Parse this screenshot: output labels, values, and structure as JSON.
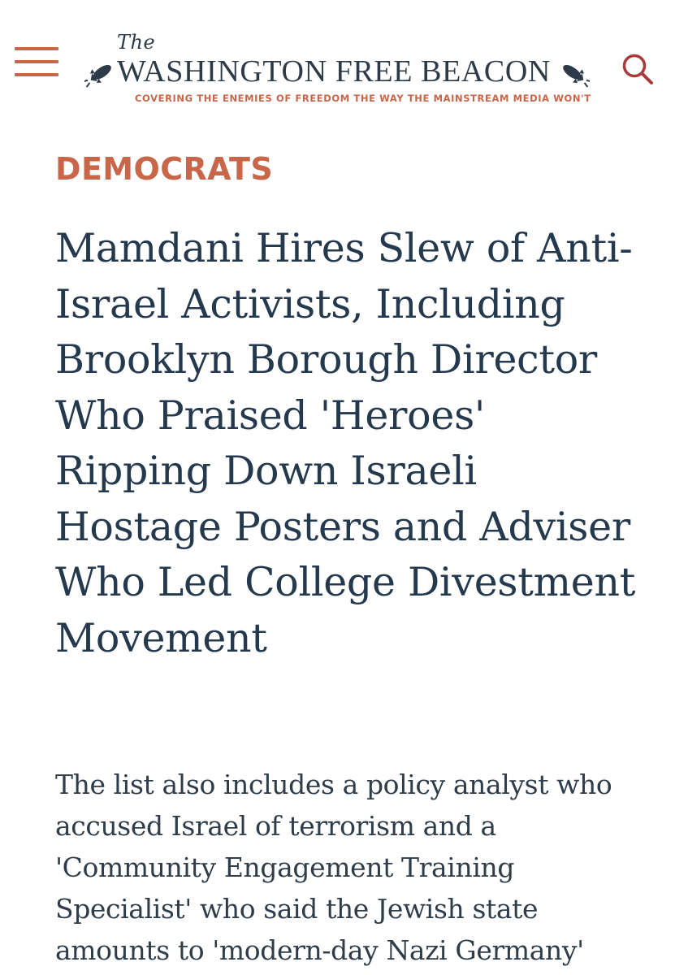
{
  "header": {
    "menu_icon": "hamburger-menu-icon",
    "logo": {
      "the": "The",
      "name": "WASHINGTON FREE BEACON",
      "tagline": "COVERING THE ENEMIES OF FREEDOM THE WAY THE MAINSTREAM MEDIA WON'T",
      "icons": [
        "rocket-icon",
        "rocket-icon"
      ]
    },
    "search_icon": "search-icon"
  },
  "article": {
    "category": "DEMOCRATS",
    "headline": "Mamdani Hires Slew of Anti-Israel Activists, Including Brooklyn Borough Director Who Praised 'Heroes' Ripping Down Israeli Hostage Posters and Adviser Who Led College Divestment Movement",
    "subheadline": "The list also includes a policy analyst who accused Israel of terrorism and a 'Community Engagement Training Specialist' who said the Jewish state amounts to 'modern-day Nazi Germany'"
  },
  "colors": {
    "accent": "#c8664a",
    "navy": "#24394d",
    "search_icon": "#a83a3a",
    "background": "#ffffff"
  }
}
